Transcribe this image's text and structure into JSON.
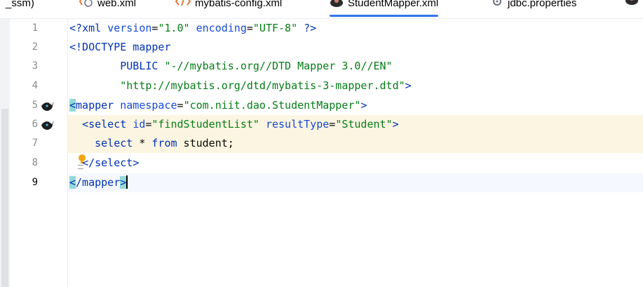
{
  "tabs": [
    {
      "label": "_ssm)",
      "icon": ""
    },
    {
      "label": "web.xml",
      "icon": "xml-file-icon"
    },
    {
      "label": "mybatis-config.xml",
      "icon": "xml-file-icon"
    },
    {
      "label": "StudentMapper.xml",
      "icon": "mybatis-bird-icon",
      "active": true
    },
    {
      "label": "jdbc.properties",
      "icon": "properties-file-icon"
    }
  ],
  "editor": {
    "line_numbers": [
      "1",
      "2",
      "3",
      "4",
      "5",
      "6",
      "7",
      "8",
      "9"
    ],
    "current_line": "9",
    "lines": [
      [
        [
          "pi",
          "<?"
        ],
        [
          "tag",
          "xml"
        ],
        [
          "t",
          " "
        ],
        [
          "attr",
          "version"
        ],
        [
          "t",
          "="
        ],
        [
          "str",
          "\"1.0\""
        ],
        [
          "t",
          " "
        ],
        [
          "attr",
          "encoding"
        ],
        [
          "t",
          "="
        ],
        [
          "str",
          "\"UTF-8\""
        ],
        [
          "t",
          " "
        ],
        [
          "pi",
          "?>"
        ]
      ],
      [
        [
          "tag",
          "<!DOCTYPE mapper"
        ]
      ],
      [
        [
          "t",
          "        "
        ],
        [
          "tag",
          "PUBLIC"
        ],
        [
          "t",
          " "
        ],
        [
          "str",
          "\"-//mybatis.org//DTD Mapper 3.0//EN\""
        ]
      ],
      [
        [
          "t",
          "        "
        ],
        [
          "str",
          "\"http://mybatis.org/dtd/mybatis-3-mapper.dtd\""
        ],
        [
          "tag",
          ">"
        ]
      ],
      [
        [
          "tagm",
          "<mapper"
        ],
        [
          "t",
          " "
        ],
        [
          "attr",
          "namespace"
        ],
        [
          "t",
          "="
        ],
        [
          "str",
          "\"com.niit.dao.StudentMapper\""
        ],
        [
          "tag",
          ">"
        ]
      ],
      [
        [
          "t",
          "  "
        ],
        [
          "tag",
          "<select"
        ],
        [
          "t",
          " "
        ],
        [
          "attr",
          "id"
        ],
        [
          "t",
          "="
        ],
        [
          "str",
          "\"findStudentList\""
        ],
        [
          "t",
          " "
        ],
        [
          "attr",
          "resultType"
        ],
        [
          "t",
          "="
        ],
        [
          "str",
          "\"Student\""
        ],
        [
          "tag",
          ">"
        ]
      ],
      [
        [
          "t",
          "    "
        ],
        [
          "kw",
          "select"
        ],
        [
          "t",
          " * "
        ],
        [
          "kw",
          "from"
        ],
        [
          "t",
          " student;"
        ]
      ],
      [
        [
          "t",
          "  "
        ],
        [
          "tag",
          "</select"
        ],
        [
          "tag",
          ">"
        ]
      ],
      [
        [
          "tagm",
          "</mapper"
        ],
        [
          "tagmEnd",
          ">"
        ]
      ]
    ]
  },
  "colors": {
    "tag": "#0033b3",
    "attr": "#174ad4",
    "string": "#067d17",
    "highlight_block": "#fcf5e1",
    "current_line": "#f5f8fe",
    "tag_match": "#93d9d9",
    "active_tab_underline": "#3574f0"
  }
}
